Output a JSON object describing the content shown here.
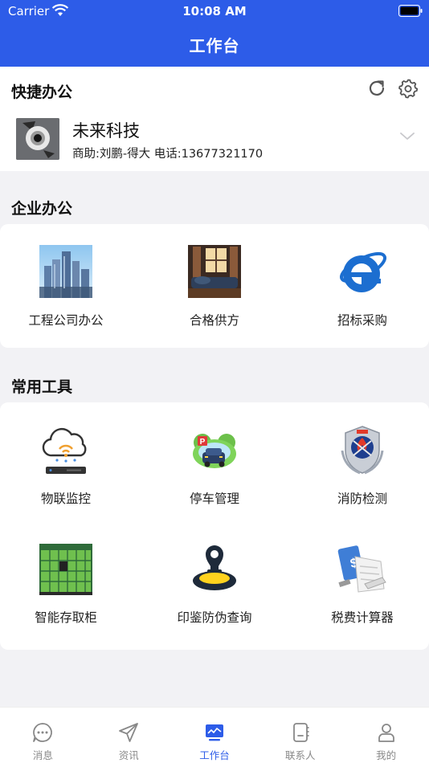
{
  "status_bar": {
    "carrier": "Carrier",
    "time": "10:08 AM"
  },
  "header": {
    "title": "工作台"
  },
  "quick_office": {
    "title": "快捷办公",
    "company": {
      "name": "未来科技",
      "subtitle": "商助:刘鹏-得大   电话:13677321170"
    }
  },
  "enterprise_office": {
    "title": "企业办公",
    "items": [
      {
        "label": "工程公司办公",
        "icon": "city-skyline-photo"
      },
      {
        "label": "合格供方",
        "icon": "living-room-photo"
      },
      {
        "label": "招标采购",
        "icon": "internet-explorer-icon"
      }
    ]
  },
  "common_tools": {
    "title": "常用工具",
    "items": [
      {
        "label": "物联监控",
        "icon": "iot-cloud-router-icon"
      },
      {
        "label": "停车管理",
        "icon": "parking-car-icon"
      },
      {
        "label": "消防检测",
        "icon": "fire-badge-icon"
      },
      {
        "label": "智能存取柜",
        "icon": "smart-locker-icon"
      },
      {
        "label": "印鉴防伪查询",
        "icon": "stamp-icon"
      },
      {
        "label": "税费计算器",
        "icon": "tax-document-icon"
      }
    ]
  },
  "tabbar": {
    "active_index": 2,
    "items": [
      {
        "label": "消息",
        "icon": "message-icon"
      },
      {
        "label": "资讯",
        "icon": "send-icon"
      },
      {
        "label": "工作台",
        "icon": "dashboard-icon"
      },
      {
        "label": "联系人",
        "icon": "contacts-icon"
      },
      {
        "label": "我的",
        "icon": "profile-icon"
      }
    ]
  },
  "colors": {
    "primary": "#2d5ce8",
    "background": "#f2f2f5",
    "inactive": "#888888"
  }
}
